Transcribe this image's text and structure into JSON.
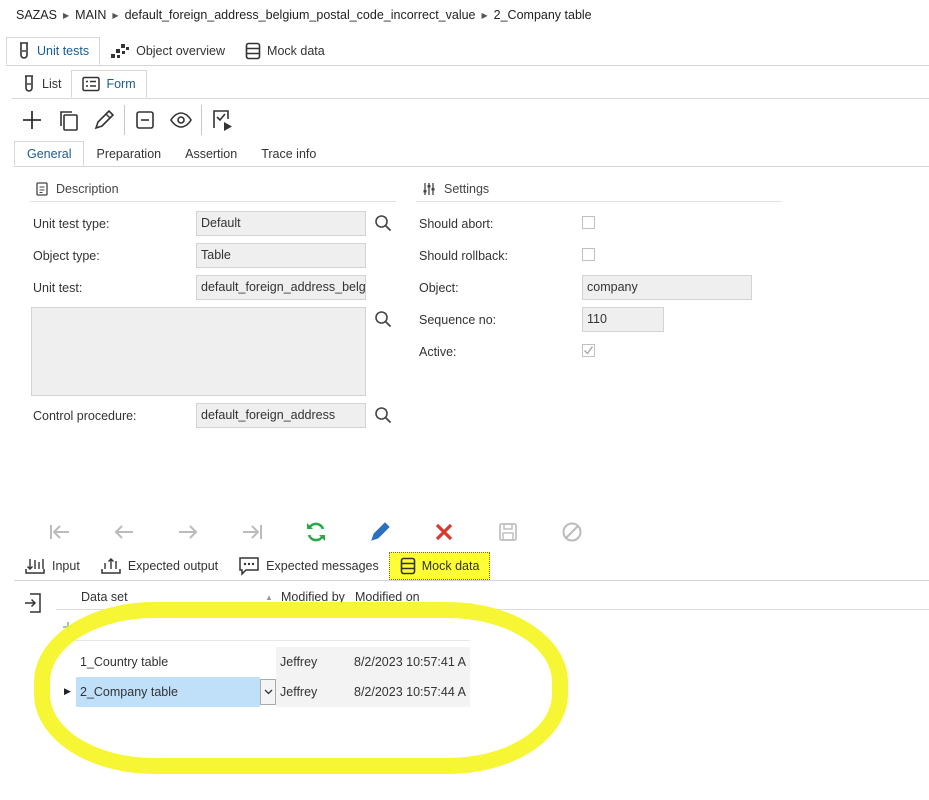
{
  "breadcrumb": [
    "SAZAS",
    "MAIN",
    "default_foreign_address_belgium_postal_code_incorrect_value",
    "2_Company table"
  ],
  "main_tabs": [
    {
      "label": "Unit tests",
      "icon": "test-tube-icon"
    },
    {
      "label": "Object overview",
      "icon": "object-overview-icon"
    },
    {
      "label": "Mock data",
      "icon": "mock-data-icon"
    }
  ],
  "view_tabs": [
    {
      "label": "List",
      "icon": "test-tube-icon"
    },
    {
      "label": "Form",
      "icon": "form-icon"
    }
  ],
  "sub_tabs": [
    "General",
    "Preparation",
    "Assertion",
    "Trace info"
  ],
  "description": {
    "title": "Description",
    "unit_test_type_label": "Unit test type:",
    "unit_test_type_value": "Default",
    "object_type_label": "Object type:",
    "object_type_value": "Table",
    "unit_test_label": "Unit test:",
    "unit_test_value": "default_foreign_address_belgium_postal_code_incorrect_value",
    "control_procedure_label": "Control procedure:",
    "control_procedure_value": "default_foreign_address"
  },
  "settings": {
    "title": "Settings",
    "should_abort_label": "Should abort:",
    "should_abort": false,
    "should_rollback_label": "Should rollback:",
    "should_rollback": false,
    "object_label": "Object:",
    "object_value": "company",
    "sequence_label": "Sequence no:",
    "sequence_value": "110",
    "active_label": "Active:",
    "active": true
  },
  "detail_tabs": [
    {
      "label": "Input",
      "icon": "input-icon"
    },
    {
      "label": "Expected output",
      "icon": "expected-output-icon"
    },
    {
      "label": "Expected messages",
      "icon": "message-icon"
    },
    {
      "label": "Mock data",
      "icon": "mock-data-icon"
    }
  ],
  "grid": {
    "columns": [
      "Data set",
      "Modified by",
      "Modified on"
    ],
    "rows": [
      {
        "data_set": "1_Country table",
        "modified_by": "Jeffrey",
        "modified_on": "8/2/2023 10:57:41 A"
      },
      {
        "data_set": "2_Company table",
        "modified_by": "Jeffrey",
        "modified_on": "8/2/2023 10:57:44 A"
      }
    ]
  },
  "colors": {
    "accent": "#1a5a96",
    "highlight": "#f6f62a",
    "selected_row": "#bfe0f8",
    "refresh": "#2aa84a",
    "cancel": "#d8392b"
  }
}
